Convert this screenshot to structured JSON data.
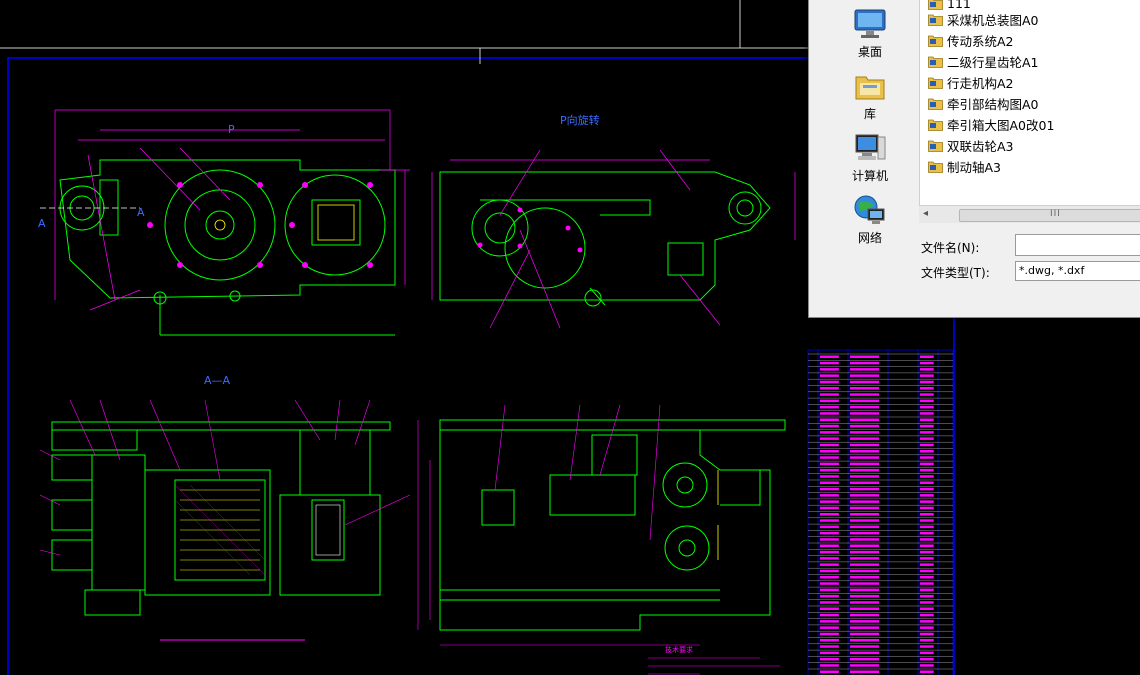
{
  "drawing": {
    "view_title_p": "P向旋转",
    "section_title": "A—A",
    "section_mark_left": "A",
    "section_mark_right": "A",
    "view_mark_p": "P",
    "tech_req_title": "技术要求"
  },
  "dialog": {
    "places": [
      {
        "label": "桌面",
        "icon": "desktop-icon"
      },
      {
        "label": "库",
        "icon": "library-icon"
      },
      {
        "label": "计算机",
        "icon": "computer-icon"
      },
      {
        "label": "网络",
        "icon": "network-icon"
      }
    ],
    "files": [
      "111",
      "采煤机总装图A0",
      "传动系统A2",
      "二级行星齿轮A1",
      "行走机构A2",
      "牵引部结构图A0",
      "牵引箱大图A0改01",
      "双联齿轮A3",
      "制动轴A3"
    ],
    "filename_label": "文件名(N):",
    "filename_value": "",
    "filetype_label": "文件类型(T):",
    "filetype_value": "*.dwg, *.dxf",
    "scroll_grip": "III",
    "scroll_arrow": "◂"
  },
  "colors": {
    "cad_green": "#00ff00",
    "cad_magenta": "#ff00ff",
    "cad_blue": "#0000ff",
    "cad_yellow": "#ffff00",
    "folder_yellow": "#e8c04a"
  }
}
